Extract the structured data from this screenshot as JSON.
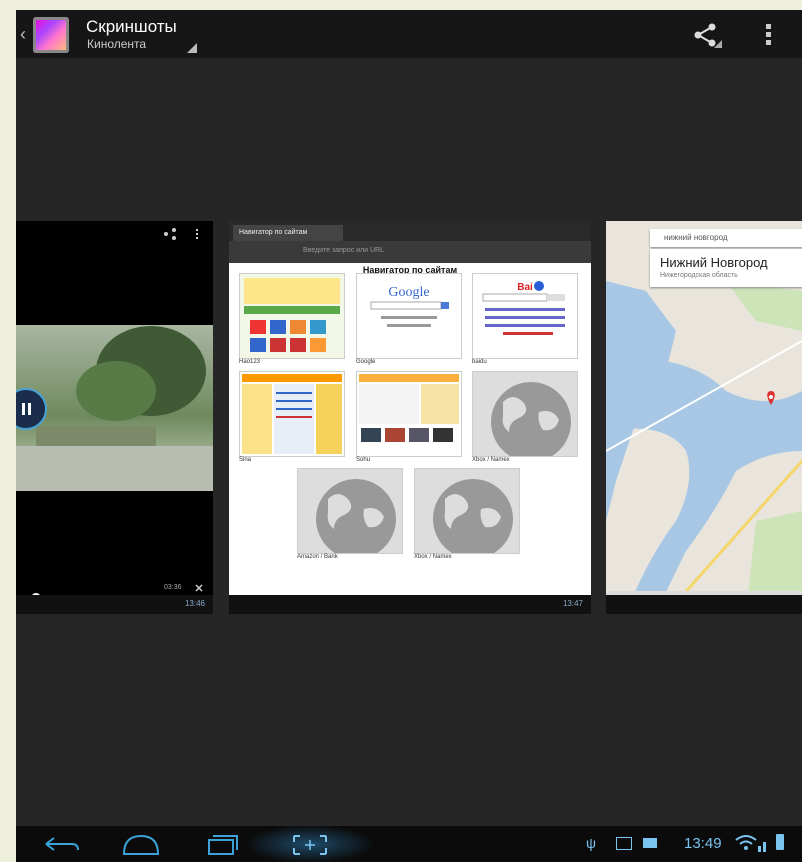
{
  "action_bar": {
    "title": "Скриншоты",
    "subtitle": "Кинолента",
    "share_icon": "share-icon",
    "overflow_icon": "overflow-menu-icon"
  },
  "frames": {
    "video": {
      "time": "03:36",
      "mini_clock": "13:46"
    },
    "browser": {
      "tab_label": "Навигатор по сайтам",
      "url_placeholder": "Введите запрос или URL",
      "page_title": "Навигатор по сайтам",
      "thumbnails": [
        {
          "label": "Hao123"
        },
        {
          "label": "Google"
        },
        {
          "label": "baidu"
        },
        {
          "label": "Sina"
        },
        {
          "label": "Sohu"
        },
        {
          "label": "Xbox / Nameх"
        },
        {
          "label": "Amazon / Bank"
        },
        {
          "label": "Xbox / Nameх"
        }
      ],
      "mini_clock": "13:47"
    },
    "map": {
      "search_text": "нижний новгород",
      "city": "Нижний Новгород",
      "region": "Нижегородская область"
    }
  },
  "system_bar": {
    "clock": "13:49",
    "accent": "#33b5e5"
  }
}
